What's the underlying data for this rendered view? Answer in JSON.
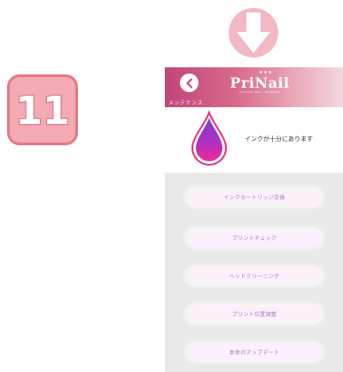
{
  "step": {
    "number": "11"
  },
  "app": {
    "brand_name": "PriNail",
    "brand_tagline": "DIGITAL NAIL PRINTER",
    "section_title": "メンテナンス"
  },
  "ink": {
    "status": "インクが十分にあります"
  },
  "menu": [
    {
      "label": "インクカートリッジ交換"
    },
    {
      "label": "プリントチェック"
    },
    {
      "label": "ヘッドクリーニング"
    },
    {
      "label": "プリント位置調整"
    },
    {
      "label": "本体のアップデート"
    }
  ],
  "colors": {
    "badge_fill": "#f4aab2",
    "badge_border": "#e07a86",
    "arrow": "#f2b8c3",
    "header_start": "#c2457b",
    "button_text": "#b073c5"
  }
}
